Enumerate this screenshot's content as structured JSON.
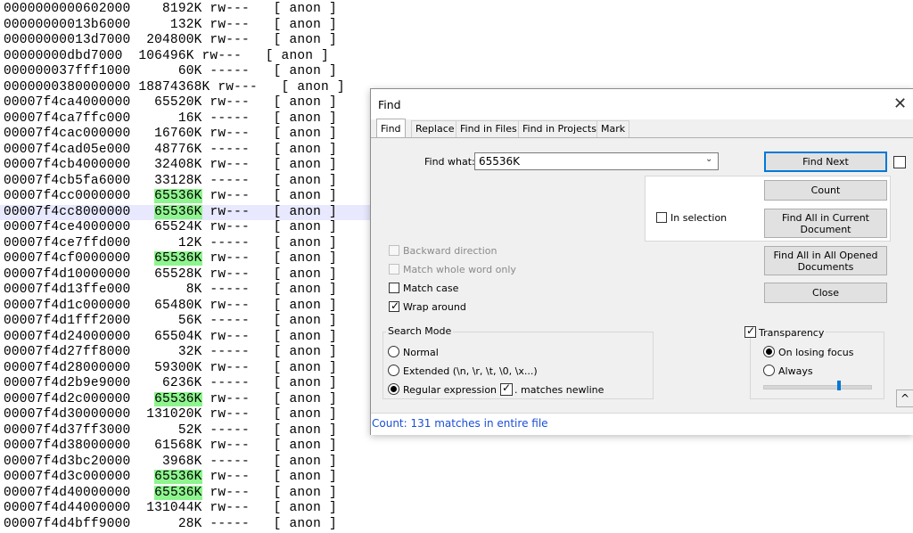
{
  "editor": {
    "highlight_term": "65536K",
    "current_line_index": 13,
    "lines": [
      "0000000000602000    8192K rw---   [ anon ]",
      "00000000013b6000     132K rw---   [ anon ]",
      "00000000013d7000  204800K rw---   [ anon ]",
      "00000000dbd7000  106496K rw---   [ anon ]",
      "000000037fff1000      60K -----   [ anon ]",
      "0000000380000000 18874368K rw---   [ anon ]",
      "00007f4ca4000000   65520K rw---   [ anon ]",
      "00007f4ca7ffc000      16K -----   [ anon ]",
      "00007f4cac000000   16760K rw---   [ anon ]",
      "00007f4cad05e000   48776K -----   [ anon ]",
      "00007f4cb4000000   32408K rw---   [ anon ]",
      "00007f4cb5fa6000   33128K -----   [ anon ]",
      "00007f4cc0000000   65536K rw---   [ anon ]",
      "00007f4cc8000000   65536K rw---   [ anon ]",
      "00007f4ce4000000   65524K rw---   [ anon ]",
      "00007f4ce7ffd000      12K -----   [ anon ]",
      "00007f4cf0000000   65536K rw---   [ anon ]",
      "00007f4d10000000   65528K rw---   [ anon ]",
      "00007f4d13ffe000       8K -----   [ anon ]",
      "00007f4d1c000000   65480K rw---   [ anon ]",
      "00007f4d1fff2000      56K -----   [ anon ]",
      "00007f4d24000000   65504K rw---   [ anon ]",
      "00007f4d27ff8000      32K -----   [ anon ]",
      "00007f4d28000000   59300K rw---   [ anon ]",
      "00007f4d2b9e9000    6236K -----   [ anon ]",
      "00007f4d2c000000   65536K rw---   [ anon ]",
      "00007f4d30000000  131020K rw---   [ anon ]",
      "00007f4d37ff3000      52K -----   [ anon ]",
      "00007f4d38000000   61568K rw---   [ anon ]",
      "00007f4d3bc20000    3968K -----   [ anon ]",
      "00007f4d3c000000   65536K rw---   [ anon ]",
      "00007f4d40000000   65536K rw---   [ anon ]",
      "00007f4d44000000  131044K rw---   [ anon ]",
      "00007f4d4bff9000      28K -----   [ anon ]"
    ]
  },
  "dialog": {
    "title": "Find",
    "close_glyph": "✕",
    "tabs": [
      "Find",
      "Replace",
      "Find in Files",
      "Find in Projects",
      "Mark"
    ],
    "find_what_label": "Find what:",
    "find_what_value": "65536K",
    "in_selection_label": "In selection",
    "buttons": {
      "find_next": "Find Next",
      "count": "Count",
      "find_all_current": "Find All in Current Document",
      "find_all_opened": "Find All in All Opened Documents",
      "close": "Close",
      "collapse": "^"
    },
    "options": {
      "backward_direction": "Backward direction",
      "match_whole_word": "Match whole word only",
      "match_case": "Match case",
      "wrap_around": "Wrap around"
    },
    "search_mode": {
      "title": "Search Mode",
      "normal": "Normal",
      "extended": "Extended (\\n, \\r, \\t, \\0, \\x...)",
      "regex": "Regular expression",
      "matches_newline": ". matches newline"
    },
    "transparency": {
      "title": "Transparency",
      "on_losing_focus": "On losing focus",
      "always": "Always",
      "level_percent": 70
    },
    "status": "Count: 131 matches in entire file",
    "colors": {
      "highlight": "#8ef58e",
      "status_text": "#1a4fd6",
      "default_button_border": "#0078d7"
    }
  }
}
